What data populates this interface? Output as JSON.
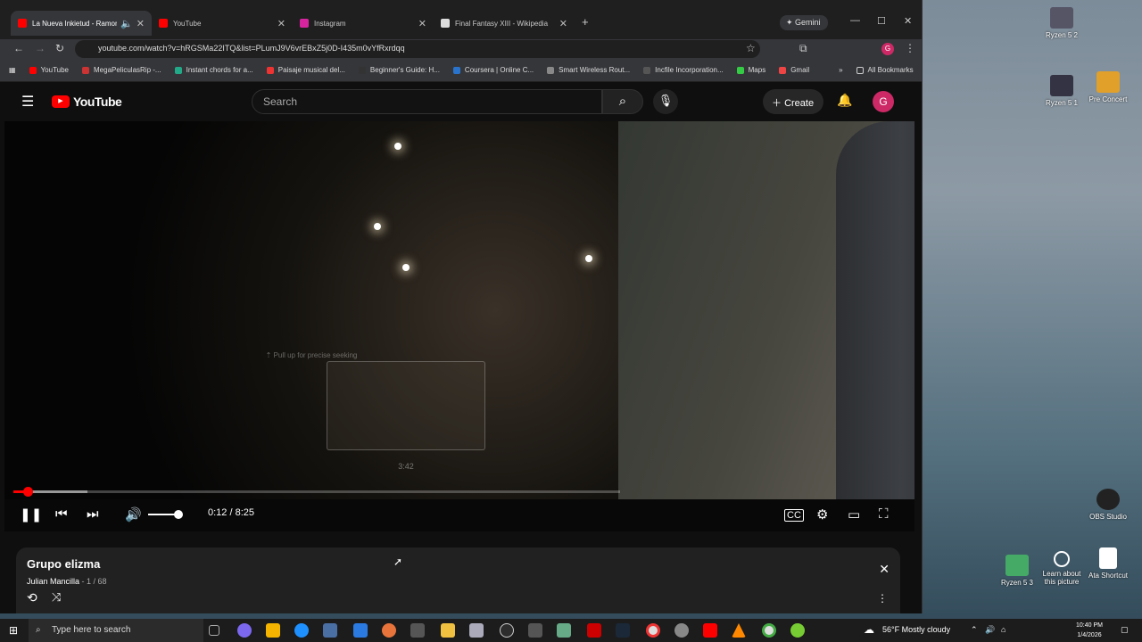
{
  "colors": {
    "youtube_red": "#ff0000",
    "chrome_dark": "#1f1f1f",
    "playlist_bg": "#212121",
    "avatar": "#cc2966"
  },
  "desktop": {
    "icons": [
      {
        "label": "Ryzen 5 2",
        "icon": "monitor-icon"
      },
      {
        "label": "Ryzen 5 1",
        "icon": "monitor-icon"
      },
      {
        "label": "Pre Concert",
        "icon": "folder-icon"
      },
      {
        "label": "OBS Studio",
        "icon": "obs-icon"
      },
      {
        "label": "Ryzen 5 3",
        "icon": "monitor-icon"
      },
      {
        "label": "Learn about this picture",
        "icon": "camera-icon"
      },
      {
        "label": "Ata Shortcut",
        "icon": "document-icon"
      }
    ]
  },
  "browser": {
    "tabs": [
      {
        "title": "La Nueva Inkietud - Ramon",
        "active": true
      },
      {
        "title": "YouTube",
        "active": false
      },
      {
        "title": "Instagram",
        "active": false
      },
      {
        "title": "Final Fantasy XIII - Wikipedia",
        "active": false
      }
    ],
    "gemini_label": "Gemini",
    "address": "youtube.com/watch?v=hRGSMa22ITQ&list=PLumJ9V6vrEBxZ5j0D-I435m0vYfRxrdqq",
    "bookmarks": [
      "YouTube",
      "MegaPeliculasRip -...",
      "Instant chords for a...",
      "Paisaje musical del...",
      "Beginner's Guide: H...",
      "Coursera | Online C...",
      "Smart Wireless Rout...",
      "Incfile Incorporation...",
      "Maps",
      "Gmail"
    ],
    "all_bookmarks": "All Bookmarks"
  },
  "youtube": {
    "logo": "YouTube",
    "search_placeholder": "Search",
    "create_label": "Create",
    "avatar_letter": "G",
    "player": {
      "seek_hint": "Pull up for precise seeking",
      "preview_time": "3:42",
      "time": "0:12 / 8:25",
      "progress_fraction": 0.024
    },
    "playlist": {
      "title": "Grupo elizma",
      "owner": "Julian Mancilla",
      "position": "1 / 68"
    }
  },
  "taskbar": {
    "search_placeholder": "Type here to search",
    "weather": "56°F  Mostly cloudy",
    "time": "10:40 PM",
    "date": "1/4/2026"
  }
}
